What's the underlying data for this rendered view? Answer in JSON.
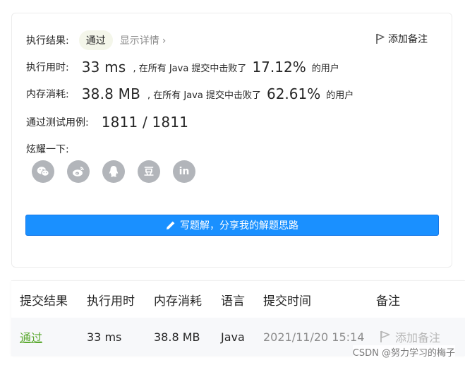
{
  "result": {
    "label": "执行结果:",
    "status": "通过",
    "details_link": "显示详情",
    "add_note": "添加备注"
  },
  "runtime": {
    "label": "执行用时:",
    "value": "33 ms",
    "prefix": ", 在所有 Java 提交中击败了",
    "percent": "17.12%",
    "suffix": "的用户"
  },
  "memory": {
    "label": "内存消耗:",
    "value": "38.8 MB",
    "prefix": ", 在所有 Java 提交中击败了",
    "percent": "62.61%",
    "suffix": "的用户"
  },
  "testcases": {
    "label": "通过测试用例:",
    "value": "1811 / 1811"
  },
  "share": {
    "label": "炫耀一下:",
    "icons": [
      "wechat-icon",
      "weibo-icon",
      "qq-icon",
      "douban-icon",
      "linkedin-icon"
    ],
    "douban_glyph": "豆",
    "linkedin_glyph": "in"
  },
  "solution_button": "写题解，分享我的解题思路",
  "table": {
    "headers": [
      "提交结果",
      "执行用时",
      "内存消耗",
      "语言",
      "提交时间",
      "备注"
    ],
    "row": {
      "result": "通过",
      "runtime": "33 ms",
      "memory": "38.8 MB",
      "language": "Java",
      "time": "2021/11/20 15:14",
      "note": "添加备注"
    }
  },
  "watermark": "CSDN @努力学习的梅子",
  "colors": {
    "primary": "#1a90ff",
    "success": "#5ba930",
    "icon_gray": "#b2b5ba"
  }
}
